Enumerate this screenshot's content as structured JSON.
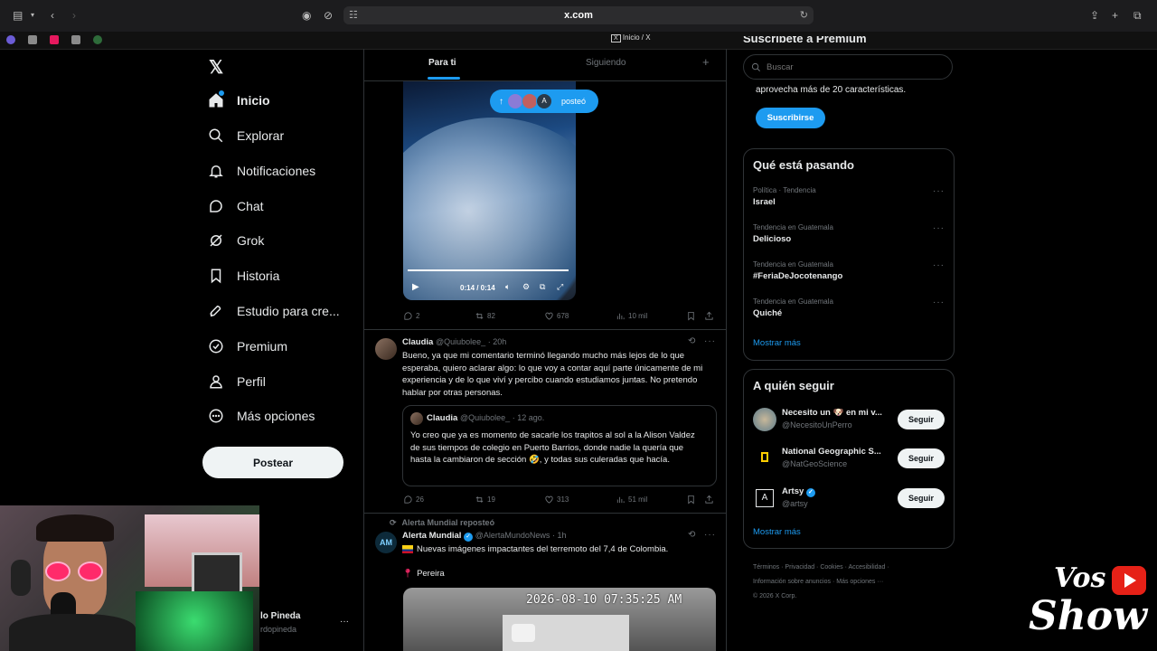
{
  "browser": {
    "url": "x.com",
    "tab_title": "Inicio / X"
  },
  "nav": {
    "items": [
      {
        "label": "Inicio",
        "icon": "home-icon"
      },
      {
        "label": "Explorar",
        "icon": "search-icon"
      },
      {
        "label": "Notificaciones",
        "icon": "bell-icon"
      },
      {
        "label": "Chat",
        "icon": "chat-icon"
      },
      {
        "label": "Grok",
        "icon": "grok-icon"
      },
      {
        "label": "Historia",
        "icon": "bookmark-icon"
      },
      {
        "label": "Estudio para cre...",
        "icon": "rocket-icon"
      },
      {
        "label": "Premium",
        "icon": "premium-icon"
      },
      {
        "label": "Perfil",
        "icon": "person-icon"
      },
      {
        "label": "Más opciones",
        "icon": "more-circle-icon"
      }
    ],
    "post_label": "Postear",
    "account_name": "lo Pineda",
    "account_handle": "rdopineda"
  },
  "feed": {
    "tabs": [
      "Para ti",
      "Siguiendo"
    ],
    "posted_pill": "posteó",
    "video_time": "0:14 / 0:14",
    "video_progress": 1.0,
    "tweet1_stats": {
      "replies": "2",
      "reposts": "82",
      "likes": "678",
      "views": "10 mil"
    },
    "tweet2": {
      "name": "Claudia",
      "handle": "@Quiubolee_",
      "time": "· 20h",
      "text": "Bueno, ya que mi comentario terminó llegando mucho más lejos de lo que esperaba, quiero aclarar algo: lo que voy a contar aquí parte únicamente de mi experiencia y de lo que viví y percibo cuando estudiamos juntas. No pretendo hablar por otras personas.",
      "quote_name": "Claudia",
      "quote_handle": "@Quiubolee_",
      "quote_time": "· 12 ago.",
      "quote_text": "Yo creo que ya es momento de sacarle los trapitos al sol a la Alison Valdez de sus tiempos de colegio en Puerto Barrios, donde nadie la quería que hasta la cambiaron de sección 🤣, y todas sus culeradas que hacía.",
      "stats": {
        "replies": "26",
        "reposts": "19",
        "likes": "313",
        "views": "51 mil"
      }
    },
    "tweet3": {
      "repost_label": "Alerta Mundial reposteó",
      "name": "Alerta Mundial",
      "handle": "@AlertaMundoNews",
      "time": "· 1h",
      "text": "Nuevas imágenes impactantes del terremoto del 7,4 de Colombia.",
      "location": "Pereira",
      "video_timestamp": "2026-08-10 07:35:25 AM"
    }
  },
  "right": {
    "search_placeholder": "Buscar",
    "premium_title": "Suscríbete a Premium",
    "premium_text": "aprovecha más de 20 características.",
    "subscribe_label": "Suscribirse",
    "trends_title": "Qué está pasando",
    "trends": [
      {
        "meta": "Política · Tendencia",
        "name": "Israel"
      },
      {
        "meta": "Tendencia en Guatemala",
        "name": "Delicioso"
      },
      {
        "meta": "Tendencia en Guatemala",
        "name": "#FeriaDeJocotenango"
      },
      {
        "meta": "Tendencia en Guatemala",
        "name": "Quiché"
      }
    ],
    "show_more": "Mostrar más",
    "follow_title": "A quién seguir",
    "follow": [
      {
        "name": "Necesito un 🐶 en mi v...",
        "handle": "@NecesitoUnPerro"
      },
      {
        "name": "National Geographic S...",
        "handle": "@NatGeoScience"
      },
      {
        "name": "Artsy",
        "handle": "@artsy"
      }
    ],
    "follow_label": "Seguir",
    "footer_line1": [
      "Términos",
      "Privacidad",
      "Cookies",
      "Accesibilidad"
    ],
    "footer_line2": [
      "Información sobre anuncios",
      "Más opciones ···"
    ],
    "copyright": "© 2026 X Corp."
  },
  "overlay": {
    "logo_text_top": "Vos",
    "logo_text_bottom": "Show"
  },
  "colors": {
    "accent": "#1d9bf0",
    "background": "#000000",
    "border": "#2f3336"
  }
}
